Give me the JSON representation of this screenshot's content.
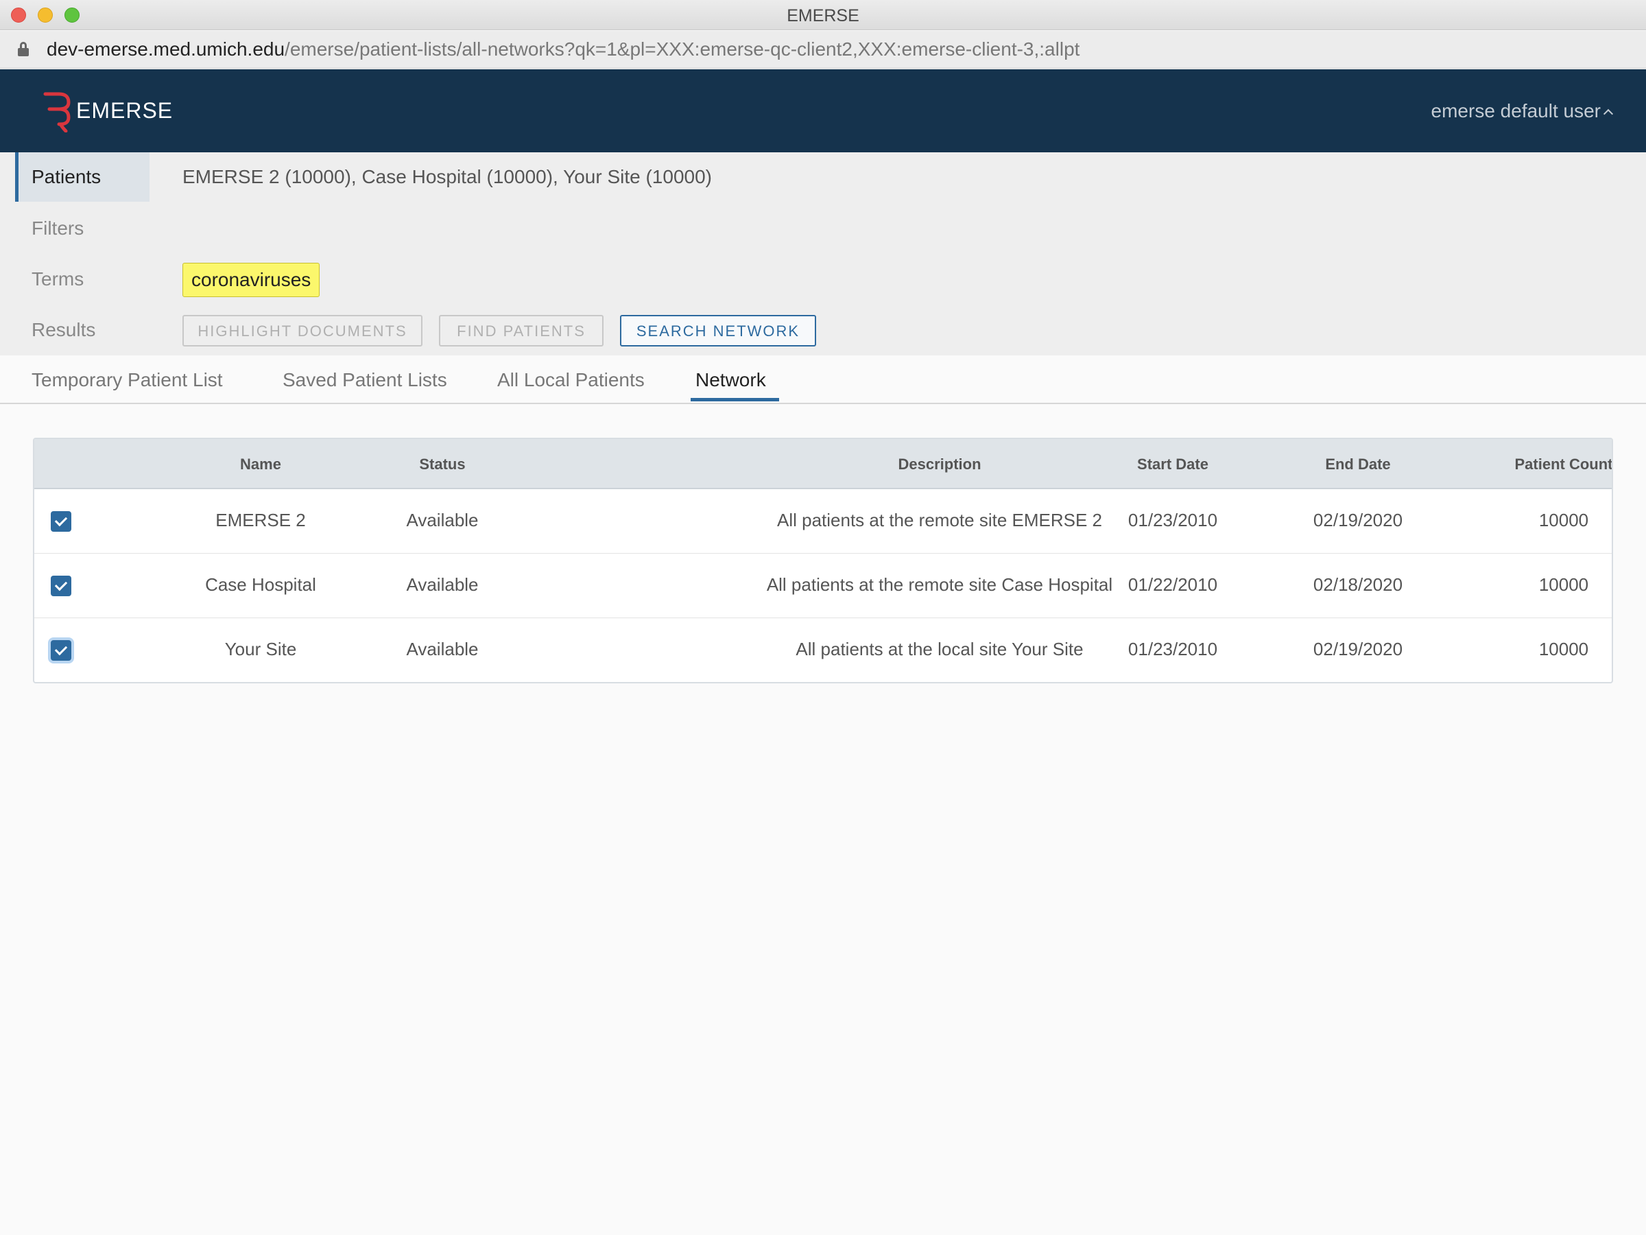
{
  "window": {
    "title": "EMERSE"
  },
  "browser": {
    "url_domain": "dev-emerse.med.umich.edu",
    "url_path": "/emerse/patient-lists/all-networks?qk=1&pl=XXX:emerse-qc-client2,XXX:emerse-client-3,:allpt"
  },
  "header": {
    "logo_text": "EMERSE",
    "user_label": "emerse default user"
  },
  "query": {
    "labels": {
      "patients": "Patients",
      "filters": "Filters",
      "terms": "Terms",
      "results": "Results"
    },
    "patients_summary": "EMERSE 2 (10000), Case Hospital (10000), Your Site (10000)",
    "term": "coronaviruses",
    "buttons": {
      "highlight": "HIGHLIGHT DOCUMENTS",
      "find": "FIND PATIENTS",
      "search_network": "SEARCH NETWORK"
    }
  },
  "tabs": [
    {
      "label": "Temporary Patient List"
    },
    {
      "label": "Saved Patient Lists"
    },
    {
      "label": "All Local Patients"
    },
    {
      "label": "Network",
      "active": true
    }
  ],
  "table": {
    "headers": {
      "name": "Name",
      "status": "Status",
      "description": "Description",
      "start": "Start Date",
      "end": "End Date",
      "count": "Patient Count"
    },
    "rows": [
      {
        "checked": true,
        "name": "EMERSE 2",
        "status": "Available",
        "description": "All patients at the remote site EMERSE 2",
        "start": "01/23/2010",
        "end": "02/19/2020",
        "count": "10000"
      },
      {
        "checked": true,
        "name": "Case Hospital",
        "status": "Available",
        "description": "All patients at the remote site Case Hospital",
        "start": "01/22/2010",
        "end": "02/18/2020",
        "count": "10000"
      },
      {
        "checked": true,
        "name": "Your Site",
        "status": "Available",
        "description": "All patients at the local site Your Site",
        "start": "01/23/2010",
        "end": "02/19/2020",
        "count": "10000"
      }
    ]
  },
  "colors": {
    "header_bg": "#15334d",
    "accent": "#2d6a9f",
    "term_highlight": "#fbf76c",
    "logo": "#d9363e"
  },
  "icons": {
    "logo": "emerse-logo-icon",
    "lock": "lock-icon",
    "user_caret": "chevron-up-icon",
    "checkbox": "checkbox-checked-icon"
  }
}
